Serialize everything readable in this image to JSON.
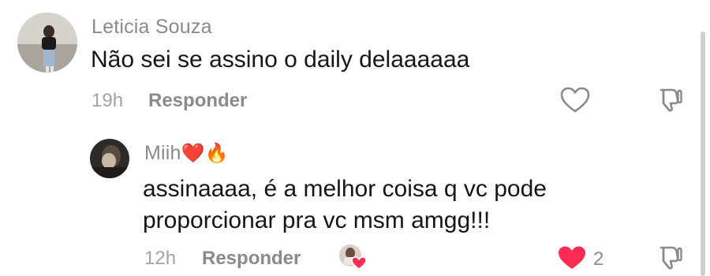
{
  "comments": [
    {
      "author": "Leticia Souza",
      "text": "Não sei se assino o daily delaaaaaa",
      "time": "19h",
      "reply_label": "Responder",
      "like_icon": "heart-outline-icon",
      "dislike_icon": "thumbs-down-icon"
    }
  ],
  "reply": {
    "author": "Miih",
    "author_emojis": "❤️🔥",
    "text_line1": "assinaaaa, é a melhor coisa q vc pode",
    "text_line2": "proporcionar pra vc msm amgg!!!",
    "time": "12h",
    "reply_label": "Responder",
    "liked_by_creator_icon": "creator-liked-heart-icon",
    "like_icon": "heart-filled-icon",
    "like_count": "2",
    "like_color": "#fe2c55",
    "dislike_icon": "thumbs-down-icon"
  }
}
